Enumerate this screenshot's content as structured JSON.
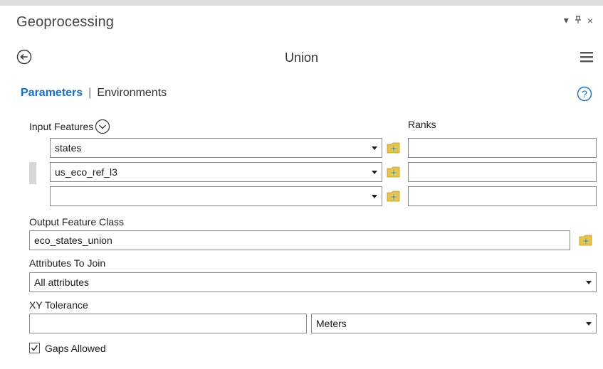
{
  "pane": {
    "title": "Geoprocessing",
    "dropdown_glyph": "▾",
    "pin_glyph": "ᵠ",
    "close_glyph": "×"
  },
  "tool": {
    "title": "Union",
    "back_icon": "back-arrow-icon",
    "menu_icon": "hamburger-menu-icon"
  },
  "tabs": {
    "parameters": "Parameters",
    "separator": "|",
    "environments": "Environments",
    "help_icon": "help-icon",
    "accent_color": "#1a6fc4"
  },
  "input_features": {
    "label": "Input Features",
    "ranks_label": "Ranks",
    "rows": [
      {
        "value": "states",
        "rank": ""
      },
      {
        "value": "us_eco_ref_l3",
        "rank": ""
      },
      {
        "value": "",
        "rank": ""
      }
    ]
  },
  "output_feature_class": {
    "label": "Output Feature Class",
    "value": "eco_states_union"
  },
  "attributes_to_join": {
    "label": "Attributes To Join",
    "value": "All attributes"
  },
  "xy_tolerance": {
    "label": "XY Tolerance",
    "value": "",
    "unit": "Meters"
  },
  "gaps_allowed": {
    "label": "Gaps Allowed",
    "checked": true
  }
}
